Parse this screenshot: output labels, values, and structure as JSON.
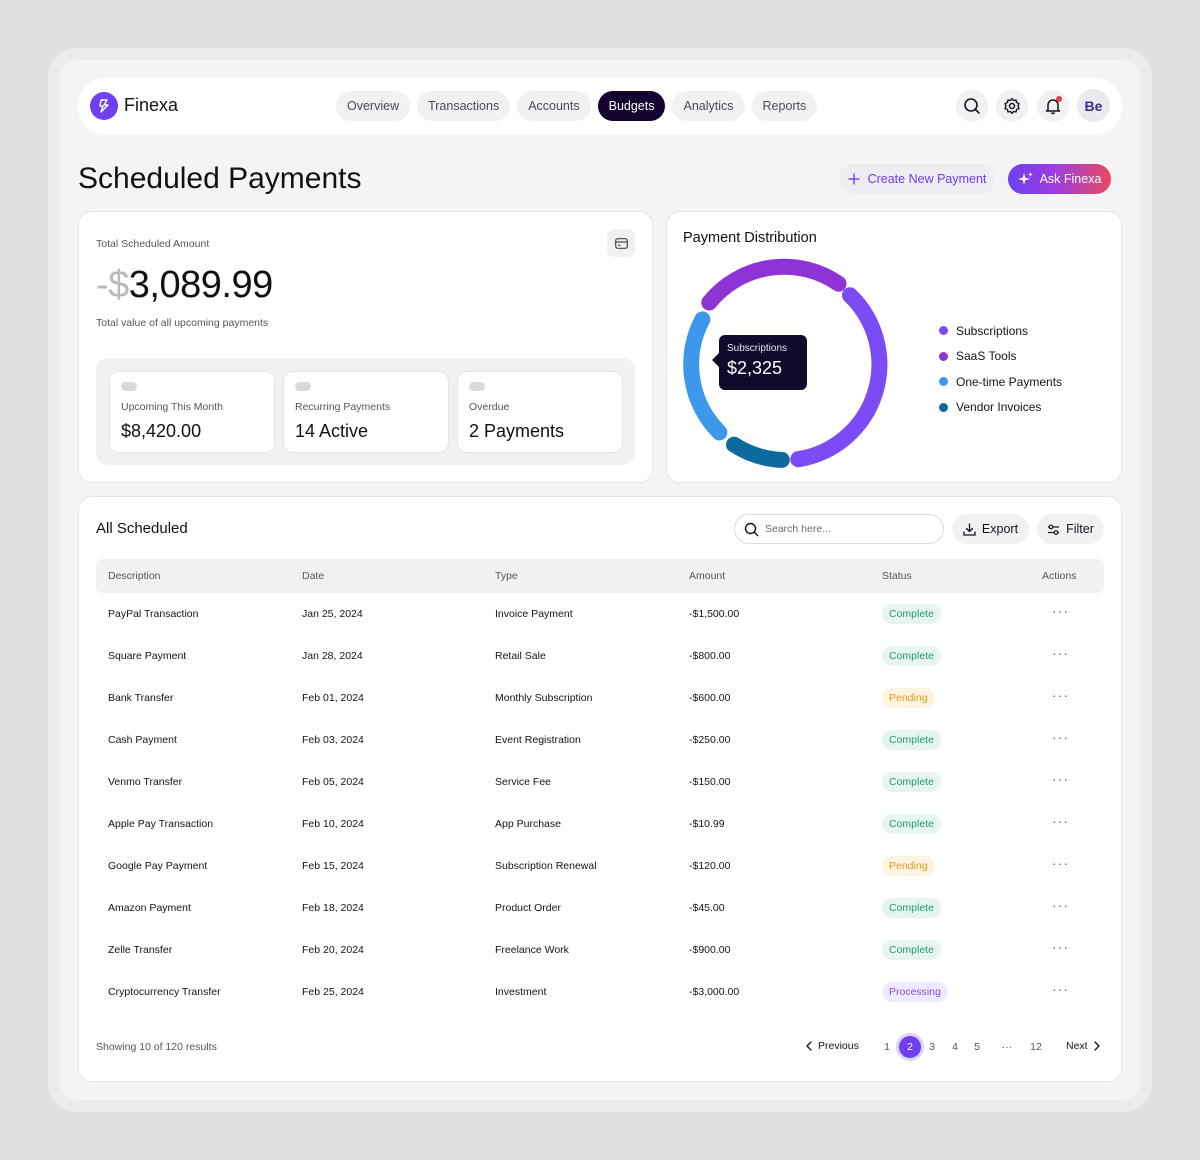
{
  "app": {
    "brand": "Finexa",
    "avatar_initials": "Be"
  },
  "nav": {
    "tabs": [
      {
        "label": "Overview"
      },
      {
        "label": "Transactions"
      },
      {
        "label": "Accounts"
      },
      {
        "label": "Budgets",
        "active": true
      },
      {
        "label": "Analytics"
      },
      {
        "label": "Reports"
      }
    ],
    "icons": [
      "search-icon",
      "gear-icon",
      "bell-icon"
    ]
  },
  "page": {
    "title": "Scheduled Payments",
    "create_button": "Create New Payment",
    "ask_button": "Ask Finexa"
  },
  "summary": {
    "label": "Total Scheduled Amount",
    "amount_prefix": "-$",
    "amount_value": "3,089.99",
    "caption": "Total value of all upcoming payments",
    "stats": [
      {
        "label": "Upcoming This Month",
        "value": "$8,420.00"
      },
      {
        "label": "Recurring Payments",
        "value": "14 Active"
      },
      {
        "label": "Overdue",
        "value": "2 Payments"
      }
    ]
  },
  "distribution": {
    "title": "Payment Distribution",
    "tooltip_label": "Subscriptions",
    "tooltip_value": "$2,325",
    "legend": [
      {
        "label": "Subscriptions",
        "color": "#7b4cf5"
      },
      {
        "label": "SaaS Tools",
        "color": "#8e34d4"
      },
      {
        "label": "One-time Payments",
        "color": "#3d98ec"
      },
      {
        "label": "Vendor Invoices",
        "color": "#0c6a9c"
      }
    ]
  },
  "table": {
    "title": "All Scheduled",
    "search_placeholder": "Search here...",
    "export_label": "Export",
    "filter_label": "Filter",
    "columns": [
      "Description",
      "Date",
      "Type",
      "Amount",
      "Status",
      "Actions"
    ],
    "rows": [
      {
        "description": "PayPal Transaction",
        "date": "Jan 25, 2024",
        "type": "Invoice Payment",
        "amount": "-$1,500.00",
        "status": "Complete"
      },
      {
        "description": "Square Payment",
        "date": "Jan 28, 2024",
        "type": "Retail Sale",
        "amount": "-$800.00",
        "status": "Complete"
      },
      {
        "description": "Bank Transfer",
        "date": "Feb 01, 2024",
        "type": "Monthly Subscription",
        "amount": "-$600.00",
        "status": "Pending"
      },
      {
        "description": "Cash Payment",
        "date": "Feb 03, 2024",
        "type": "Event Registration",
        "amount": "-$250.00",
        "status": "Complete"
      },
      {
        "description": "Venmo Transfer",
        "date": "Feb 05, 2024",
        "type": "Service Fee",
        "amount": "-$150.00",
        "status": "Complete"
      },
      {
        "description": "Apple Pay Transaction",
        "date": "Feb 10, 2024",
        "type": "App Purchase",
        "amount": "-$10.99",
        "status": "Complete"
      },
      {
        "description": "Google Pay Payment",
        "date": "Feb 15, 2024",
        "type": "Subscription Renewal",
        "amount": "-$120.00",
        "status": "Pending"
      },
      {
        "description": "Amazon Payment",
        "date": "Feb 18, 2024",
        "type": "Product Order",
        "amount": "-$45.00",
        "status": "Complete"
      },
      {
        "description": "Zelle Transfer",
        "date": "Feb 20, 2024",
        "type": "Freelance Work",
        "amount": "-$900.00",
        "status": "Complete"
      },
      {
        "description": "Cryptocurrency Transfer",
        "date": "Feb 25, 2024",
        "type": "Investment",
        "amount": "-$3,000.00",
        "status": "Processing"
      }
    ]
  },
  "pagination": {
    "summary": "Showing 10 of 120 results",
    "previous": "Previous",
    "next": "Next",
    "pages": [
      "1",
      "2",
      "3",
      "4",
      "5",
      "12"
    ],
    "ellipsis": "···",
    "current": "2"
  }
}
